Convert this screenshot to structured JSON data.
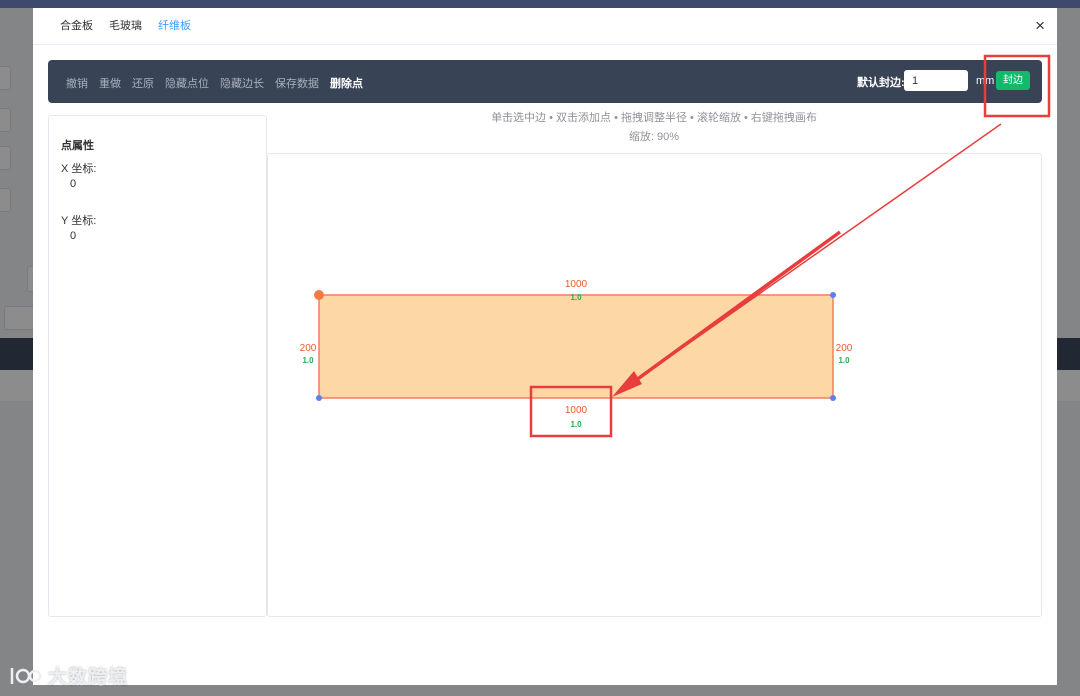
{
  "modal": {
    "tabs": [
      {
        "label": "合金板",
        "active": false
      },
      {
        "label": "毛玻璃",
        "active": false
      },
      {
        "label": "纤维板",
        "active": true
      }
    ],
    "close_symbol": "×"
  },
  "toolbar": {
    "items": [
      "撤销",
      "重做",
      "还原",
      "隐藏点位",
      "隐藏边长",
      "保存数据",
      "删除点"
    ],
    "default_edge_label": "默认封边:",
    "default_edge_value": "1",
    "unit": "mm",
    "apply_label": "封边"
  },
  "panel": {
    "title": "点属性",
    "x_label": "X 坐标:",
    "x_value": "0",
    "y_label": "Y 坐标:",
    "y_value": "0"
  },
  "canvas": {
    "hint": "单击选中边 • 双击添加点 • 拖拽调整半径 • 滚轮缩放 • 右键拖拽画布",
    "zoom": "缩放: 90%",
    "edges": {
      "top": {
        "length": "1000",
        "edge": "1.0"
      },
      "bottom": {
        "length": "1000",
        "edge": "1.0"
      },
      "left": {
        "length": "200",
        "edge": "1.0"
      },
      "right": {
        "length": "200",
        "edge": "1.0"
      }
    },
    "colors": {
      "fill": "#fdd8a4",
      "stroke": "#f47d5c",
      "length_text": "#f1582d",
      "edge_text": "#2aaa4e",
      "selected_point": "#f47a45",
      "point": "#5b7ff0"
    }
  },
  "annotation_color": "#e83d3d",
  "watermark": {
    "text": "大数跨境"
  }
}
